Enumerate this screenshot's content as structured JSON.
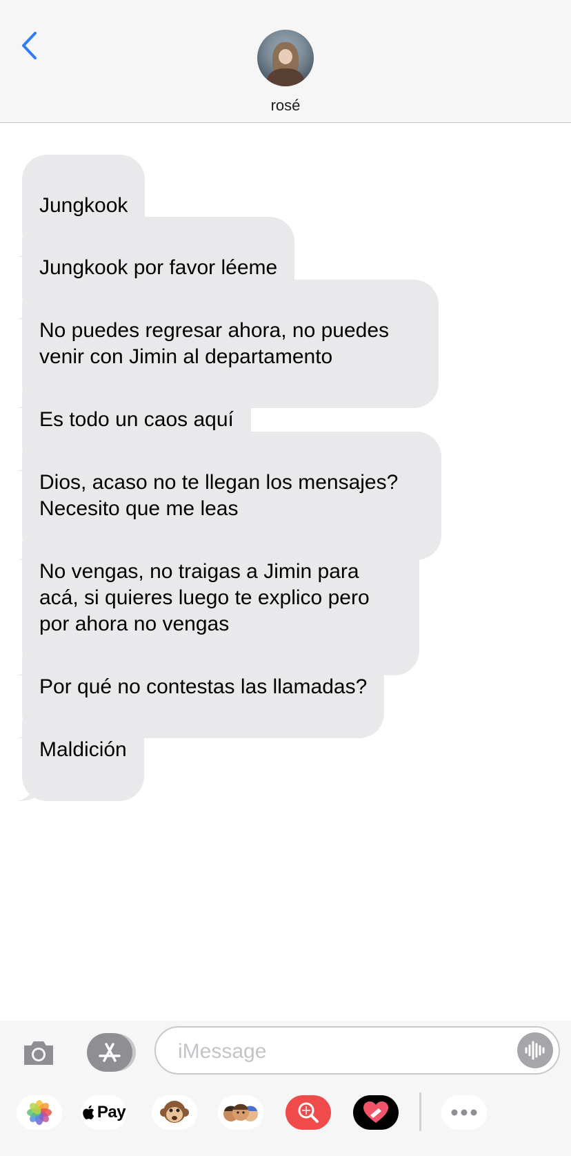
{
  "header": {
    "contact_name": "rosé",
    "back_icon": "chevron-left-icon",
    "accent_color": "#2f7cf6"
  },
  "messages": [
    "Jungkook",
    "Jungkook por favor léeme",
    "No puedes regresar ahora, no puedes venir con Jimin al departamento",
    "Es todo un caos aquí",
    "Dios, acaso no te llegan los mensajes? Necesito que me leas",
    "No vengas, no traigas a Jimin para acá, si quieres luego te explico pero por ahora no vengas",
    "Por qué no contestas las llamadas?",
    "Maldición"
  ],
  "compose": {
    "placeholder": "iMessage",
    "camera_icon": "camera-icon",
    "apps_icon": "app-store-icon",
    "audio_icon": "audio-waveform-icon"
  },
  "app_strip": {
    "apple_pay_label": "Pay",
    "items": [
      "photos-icon",
      "apple-pay-icon",
      "animoji-monkey-icon",
      "memoji-icon",
      "search-images-icon",
      "digital-touch-heart-icon",
      "more-icon"
    ]
  },
  "colors": {
    "received_bubble": "#e9e9eb",
    "header_bg": "#f6f6f6"
  }
}
